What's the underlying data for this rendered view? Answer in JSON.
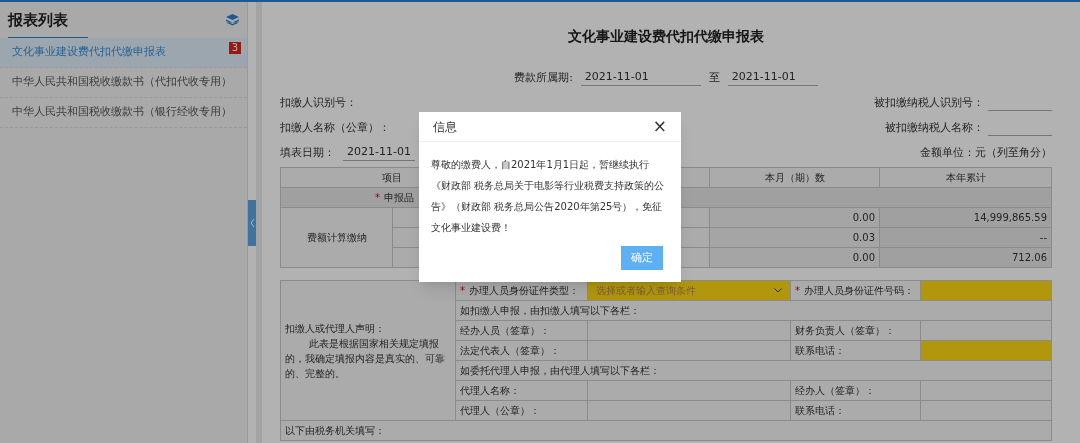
{
  "sidebar": {
    "title": "报表列表",
    "items": [
      {
        "label": "文化事业建设费代扣代缴申报表",
        "selected": true,
        "badge": "3"
      },
      {
        "label": "中华人民共和国税收缴款书（代扣代收专用）",
        "selected": false
      },
      {
        "label": "中华人民共和国税收缴款书（银行经收专用）",
        "selected": false
      }
    ]
  },
  "form": {
    "title": "文化事业建设费代扣代缴申报表",
    "period": {
      "label": "费款所属期:",
      "from": "2021-11-01",
      "separator": "至",
      "to": "2021-11-01"
    },
    "left_fields": [
      {
        "label": "扣缴人识别号："
      },
      {
        "label": "扣缴人名称（公章）："
      }
    ],
    "right_fields": [
      {
        "label": "被扣缴纳税人识别号："
      },
      {
        "label": "被扣缴纳税人名称："
      }
    ],
    "fill_date": {
      "label": "填表日期：",
      "value": "2021-11-01"
    },
    "unit": "金额单位：元（列至角分）",
    "table1": {
      "columns": [
        "项目",
        "本月（期）数",
        "本年累计"
      ],
      "item_row": {
        "mark": "*",
        "label": "申报品"
      },
      "group_label": "费额计算缴纳",
      "rows": [
        {
          "month": "0.00",
          "year": "14,999,865.59"
        },
        {
          "month": "0.03",
          "year": "--"
        },
        {
          "month": "0.00",
          "year": "712.06"
        }
      ]
    },
    "table2": {
      "declaration_title": "扣缴人或代理人声明：",
      "declaration_text": "此表是根据国家相关规定填报的，我确定填报内容是真实的、可靠的、完整的。",
      "id_type": {
        "mark": "*",
        "label": "办理人员身份证件类型：",
        "placeholder": "选择或者输入查询条件"
      },
      "id_number": {
        "mark": "*",
        "label": "办理人员身份证件号码："
      },
      "section1": "如扣缴人申报，由扣缴人填写以下各栏：",
      "section1_rows": [
        {
          "left": "经办人员（签章）：",
          "right": "财务负责人（签章）：",
          "right_highlight": false
        },
        {
          "left": "法定代表人（签章）：",
          "right": "联系电话：",
          "right_highlight": true
        }
      ],
      "section2": "如委托代理人申报，由代理人填写以下各栏：",
      "section2_rows": [
        {
          "left": "代理人名称：",
          "right": "经办人（签章）：",
          "right_highlight": false
        },
        {
          "left": "代理人（公章）：",
          "right": "联系电话：",
          "right_highlight": false
        }
      ],
      "footer": "以下由税务机关填写："
    }
  },
  "dialog": {
    "title": "信息",
    "close": "×",
    "message": "尊敬的缴费人，自2021年1月1日起，暂继续执行《财政部 税务总局关于电影等行业税费支持政策的公告》（财政部 税务总局公告2020年第25号），免征文化事业建设费！",
    "confirm": "确定"
  }
}
